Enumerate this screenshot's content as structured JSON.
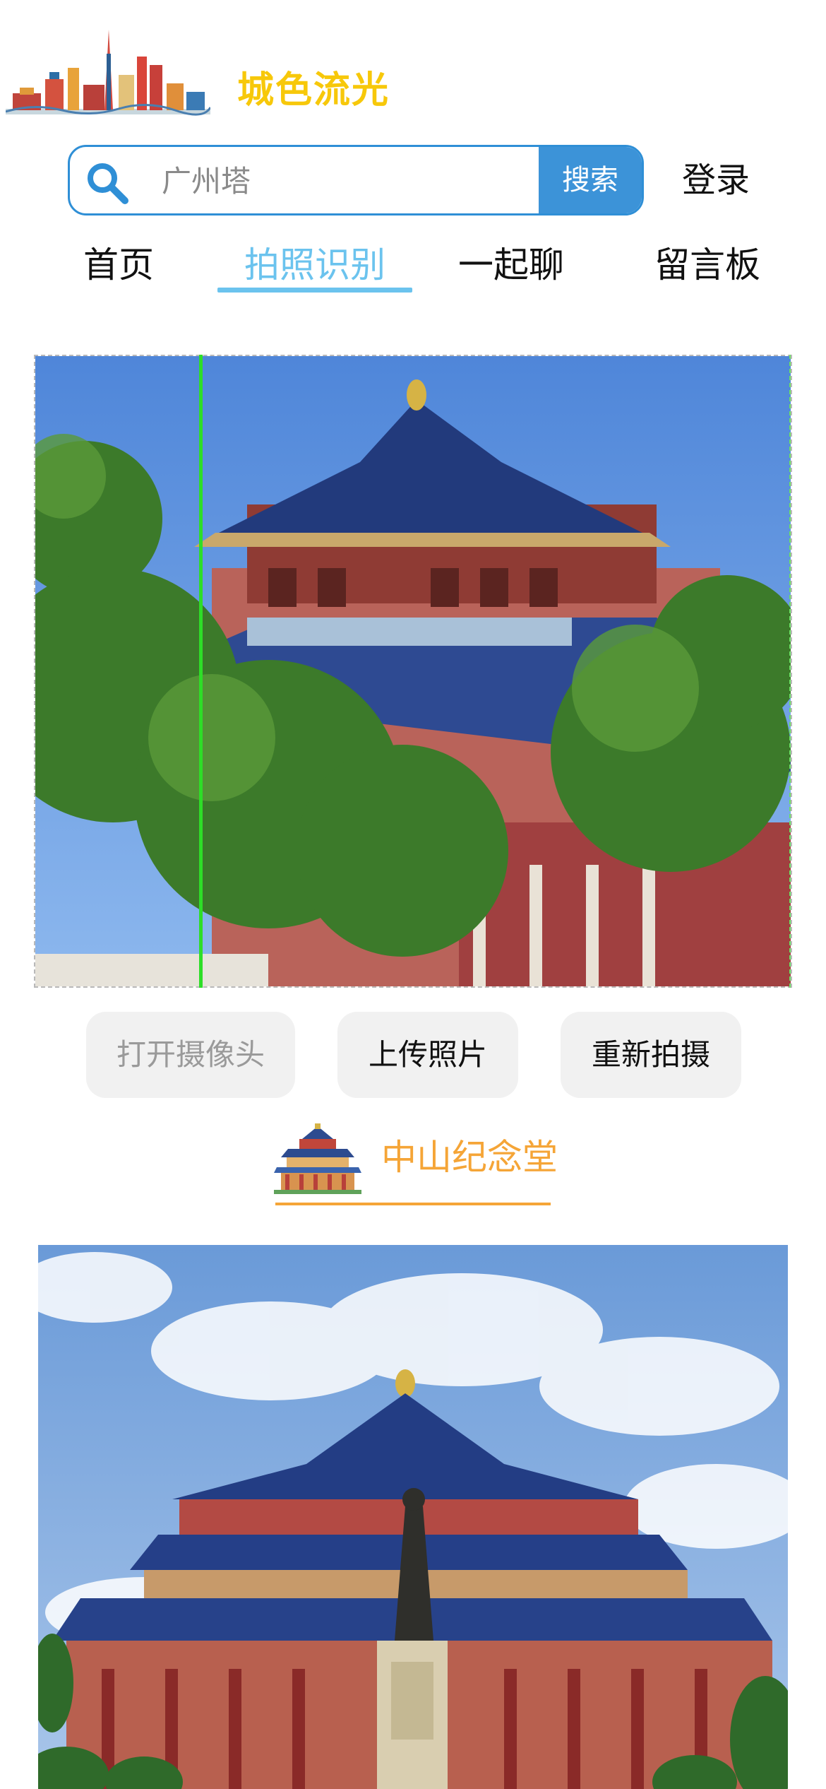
{
  "header": {
    "brand": "城色流光",
    "search": {
      "placeholder": "广州塔",
      "button_label": "搜索"
    },
    "login_label": "登录"
  },
  "nav": {
    "items": [
      {
        "label": "首页",
        "active": false
      },
      {
        "label": "拍照识别",
        "active": true
      },
      {
        "label": "一起聊",
        "active": false
      },
      {
        "label": "留言板",
        "active": false
      }
    ]
  },
  "actions": {
    "open_camera": "打开摄像头",
    "upload_photo": "上传照片",
    "retake": "重新拍摄"
  },
  "result": {
    "landmark_name": "中山纪念堂"
  },
  "colors": {
    "brand_yellow": "#f7c80a",
    "search_blue": "#3c93d8",
    "nav_active": "#6bc3ee",
    "result_orange": "#f5a537",
    "scan_line_green": "#2ede27"
  }
}
